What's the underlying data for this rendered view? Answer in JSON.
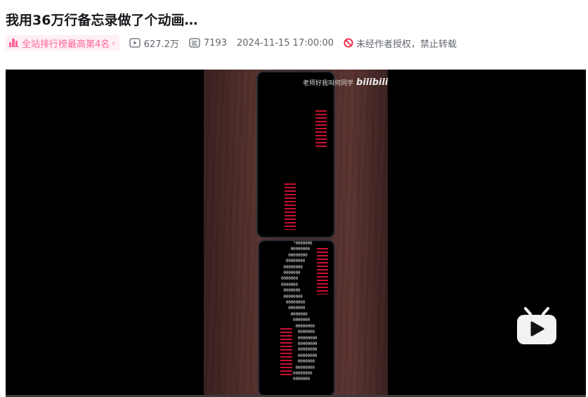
{
  "video": {
    "title": "我用36万行备忘录做了个动画…",
    "rank_label": "全站排行榜最高第4名",
    "views": "627.2万",
    "danmaku": "7193",
    "publish_time": "2024-11-15 17:00:00",
    "copyright": "未经作者授权，禁止转载"
  },
  "player": {
    "watermark_text": "老师好我叫何同学",
    "watermark_logo": "bilibili",
    "background_color": "#000000",
    "accent_pink": "#ff6699",
    "heart_red": "#c8102e"
  },
  "icons": {
    "rank": "bar-chart-icon",
    "views": "play-icon",
    "danmaku": "danmaku-icon",
    "copyright": "no-entry-icon",
    "brand": "bilibili-tv-icon"
  }
}
